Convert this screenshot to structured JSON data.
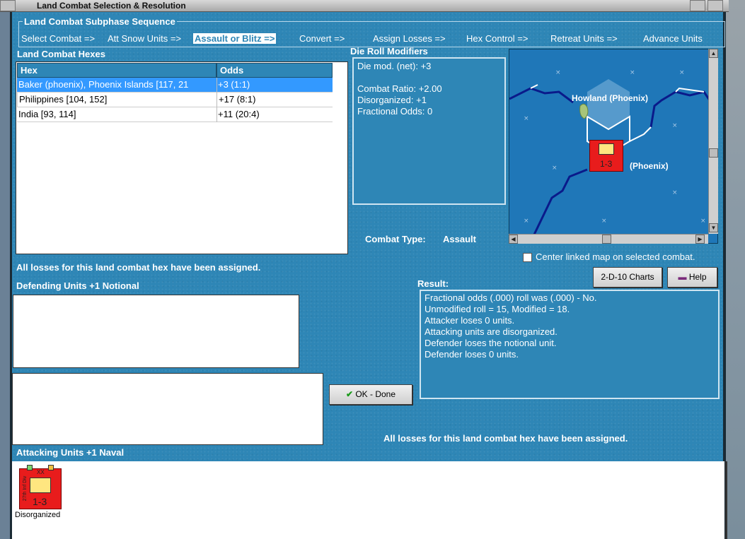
{
  "window": {
    "title": "Land Combat Selection & Resolution"
  },
  "sequence": {
    "legend": "Land Combat Subphase Sequence",
    "steps": [
      "Select Combat =>",
      "Att Snow Units =>",
      "Assault or Blitz =>",
      "Convert =>",
      "Assign Losses =>",
      "Hex Control =>",
      "Retreat Units =>",
      "Advance Units"
    ],
    "active_index": 2
  },
  "hexes": {
    "heading": "Land Combat Hexes",
    "columns": [
      "Hex",
      "Odds"
    ],
    "rows": [
      {
        "hex": "Baker (phoenix), Phoenix Islands [117, 21",
        "odds": "+3 (1:1)",
        "selected": true
      },
      {
        "hex": "Philippines [104, 152]",
        "odds": "+17 (8:1)",
        "selected": false
      },
      {
        "hex": "India [93, 114]",
        "odds": "+11 (20:4)",
        "selected": false
      }
    ]
  },
  "modifiers": {
    "heading": "Die Roll Modifiers",
    "lines": [
      "Die mod. (net): +3",
      "",
      "Combat Ratio: +2.00",
      "Disorganized: +1",
      "Fractional Odds: 0"
    ]
  },
  "map": {
    "label1": "Howland (Phoenix)",
    "label2": "(Phoenix)",
    "unit_text": "1-3"
  },
  "combat_type": {
    "label": "Combat Type:",
    "value": "Assault"
  },
  "center_linked": {
    "label": "Center linked map on selected combat.",
    "checked": false
  },
  "buttons": {
    "charts": "2-D-10 Charts",
    "help": "Help",
    "ok": "OK - Done"
  },
  "losses_msg_left": "All losses for this land combat hex have been assigned.",
  "losses_msg_right": "All losses for this land combat hex have been assigned.",
  "defending": {
    "heading": "Defending Units +1 Notional"
  },
  "result": {
    "heading": "Result:",
    "lines": [
      "Fractional odds (.000) roll was (.000)  - No.",
      "Unmodified roll = 15, Modified = 18.",
      "Attacker loses 0 units.",
      "Attacking units are disorganized.",
      "Defender loses the notional unit.",
      "Defender loses 0 units."
    ]
  },
  "attacking": {
    "heading": "Attacking Units +1 Naval",
    "unit": {
      "name": "27th Inf Div",
      "size": "XX",
      "strength": "1-3",
      "status": "Disorganized"
    }
  },
  "colors": {
    "panel": "#2e86b6",
    "selected_row": "#3399ff",
    "unit_red": "#e81c1c"
  }
}
